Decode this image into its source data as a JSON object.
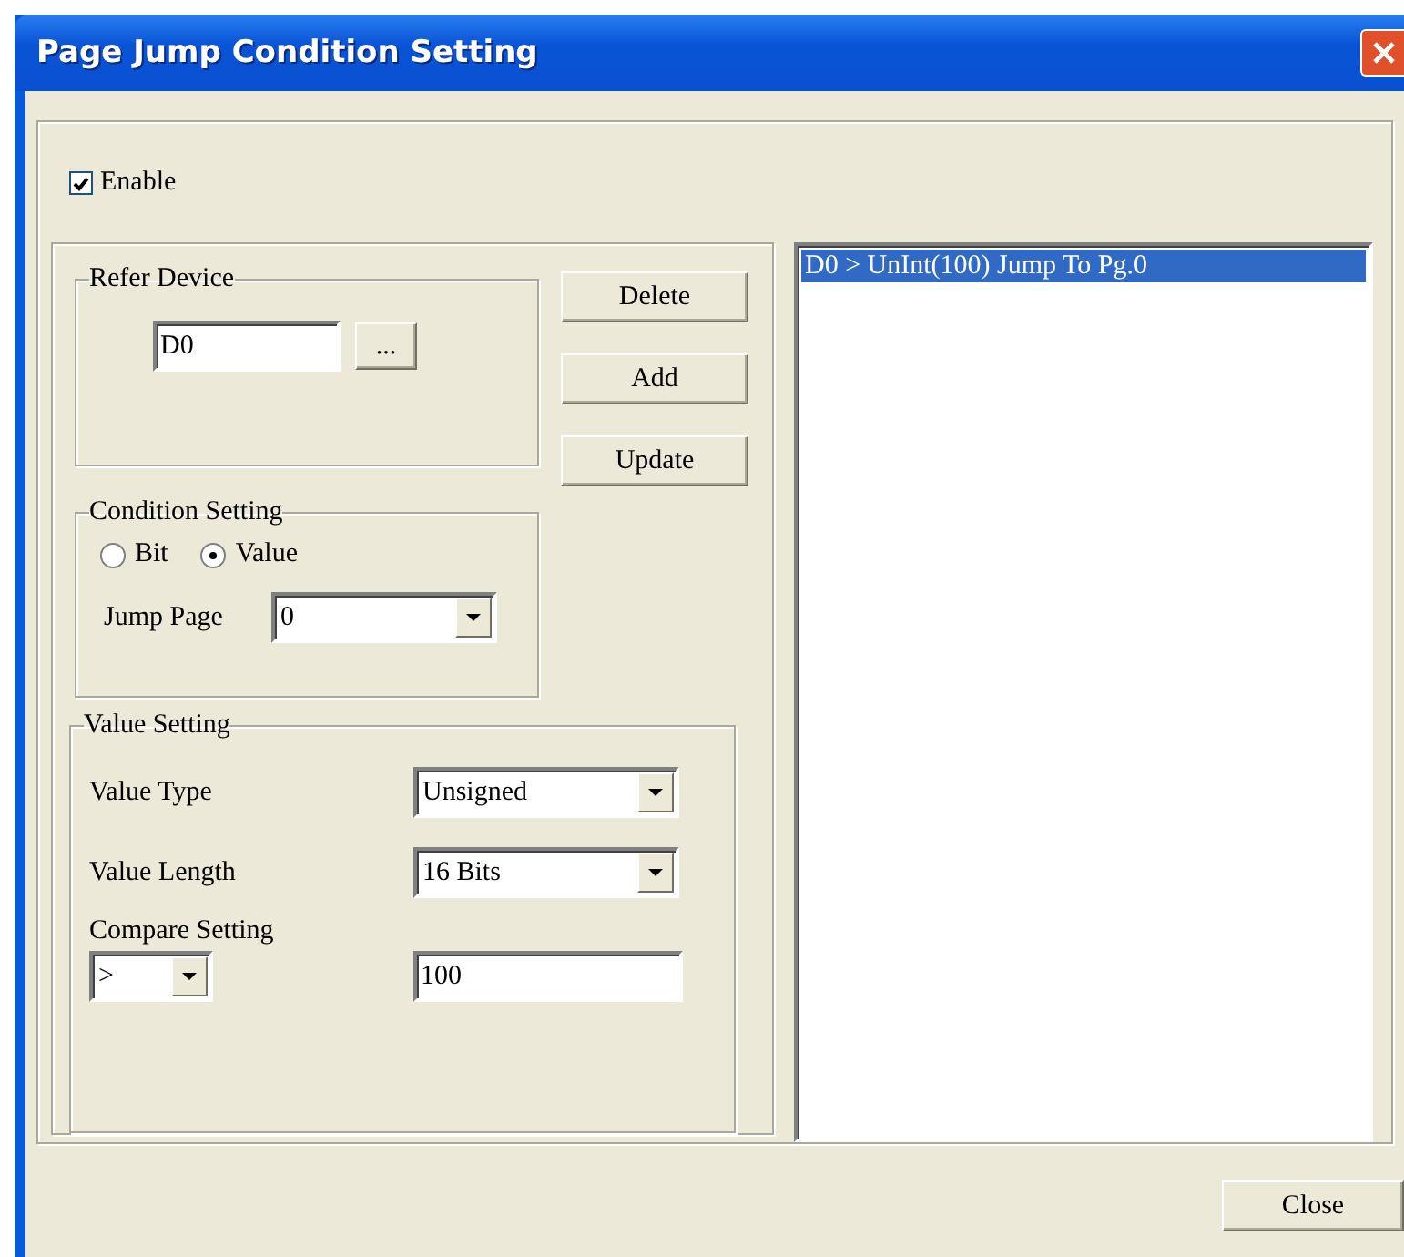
{
  "window": {
    "title": "Page Jump Condition Setting"
  },
  "enable": {
    "label": "Enable",
    "checked": true
  },
  "refer_device": {
    "title": "Refer Device",
    "device": "D0",
    "browse_button": "..."
  },
  "buttons": [
    "Delete",
    "Add",
    "Update"
  ],
  "condition_setting": {
    "title": "Condition Setting",
    "options": [
      {
        "label": "Bit",
        "selected": false
      },
      {
        "label": "Value",
        "selected": true
      }
    ],
    "jump_page": {
      "label": "Jump Page",
      "value": "0"
    }
  },
  "value_setting": {
    "title": "Value Setting",
    "value_type": {
      "label": "Value Type",
      "value": "Unsigned"
    },
    "value_length": {
      "label": "Value Length",
      "value": "16 Bits"
    },
    "compare_setting": {
      "label": "Compare Setting",
      "operator": ">",
      "value": "100"
    }
  },
  "conditions": [
    {
      "text": "D0 > UnInt(100) Jump To Pg.0",
      "selected": true
    }
  ],
  "close_button": "Close"
}
